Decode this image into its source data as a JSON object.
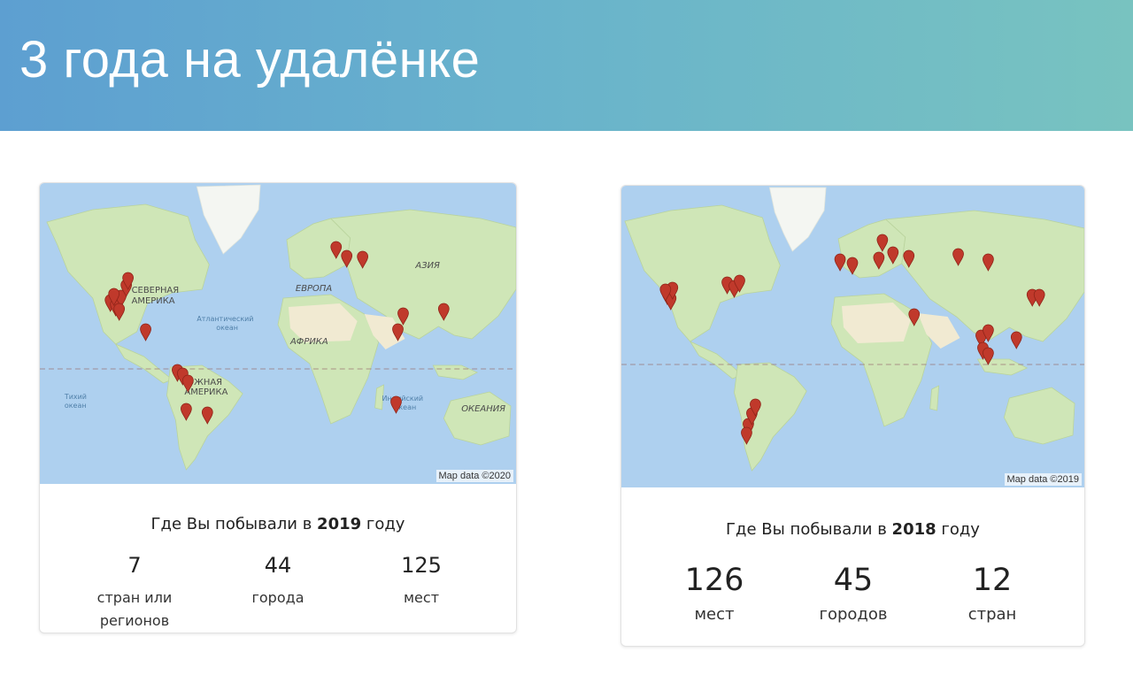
{
  "slide": {
    "title": "3 года на удалёнке"
  },
  "cards": [
    {
      "attribution": "Map data ©2020",
      "title_prefix": "Где Вы побывали в ",
      "year": "2019",
      "title_suffix": " году",
      "stats": [
        {
          "value": "7",
          "label": "стран или регионов"
        },
        {
          "value": "44",
          "label": "города"
        },
        {
          "value": "125",
          "label": "мест"
        }
      ],
      "map_labels": {
        "north_america": "СЕВЕРНАЯ АМЕРИКА",
        "south_america": "ЮЖНАЯ АМЕРИКА",
        "europe": "ЕВРОПА",
        "asia": "АЗИЯ",
        "africa": "АФРИКА",
        "oceania": "ОКЕАНИЯ",
        "atlantic": "Атлантический океан",
        "pacific": "Тихий океан",
        "indian": "Индийский океан"
      }
    },
    {
      "attribution": "Map data ©2019",
      "title_prefix": "Где Вы побывали в ",
      "year": "2018",
      "title_suffix": " году",
      "stats": [
        {
          "value": "126",
          "label": "мест"
        },
        {
          "value": "45",
          "label": "городов"
        },
        {
          "value": "12",
          "label": "стран"
        }
      ]
    }
  ],
  "colors": {
    "water": "#aed0ef",
    "land": "#cfe6b7",
    "pin": "#c0392b",
    "header_start": "#5d9fd1",
    "header_end": "#78c3c0"
  }
}
